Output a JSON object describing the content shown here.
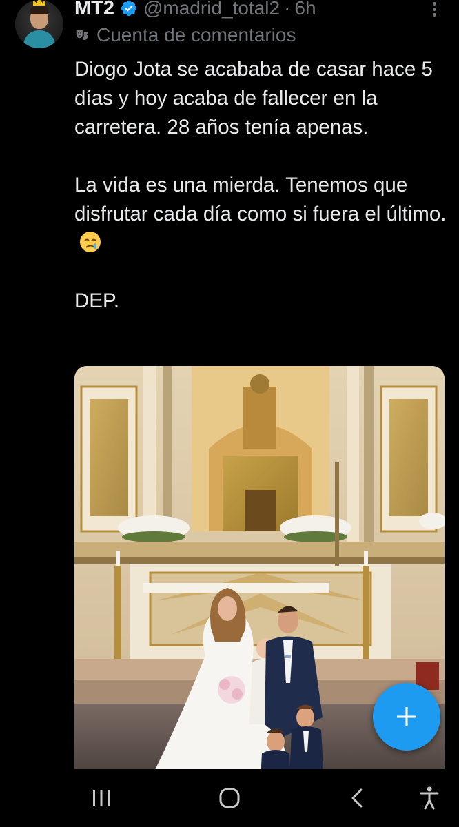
{
  "tweet": {
    "display_name": "MT2",
    "handle": "@madrid_total2",
    "separator": "·",
    "time": "6h",
    "account_label": "Cuenta de comentarios",
    "paragraphs": [
      "Diogo Jota se acababa de casar hace 5 días y hoy acaba de fallecer en la carretera. 28 años tenía apenas.",
      "La vida es una mierda. Tenemos que disfrutar cada día como si fuera el último.",
      "DEP."
    ]
  },
  "icons": {
    "avatar": "avatar-icon",
    "verified": "verified-badge-icon",
    "more": "more-options-icon",
    "mask": "theater-mask-icon",
    "emoji": "crying-face-emoji",
    "compose": "plus-icon",
    "recent_apps": "recent-apps-icon",
    "home": "home-icon",
    "back": "back-icon",
    "accessibility": "accessibility-icon"
  },
  "colors": {
    "background": "#000000",
    "text": "#e7e9ea",
    "secondary": "#71767b",
    "accent": "#1d9bf0"
  }
}
